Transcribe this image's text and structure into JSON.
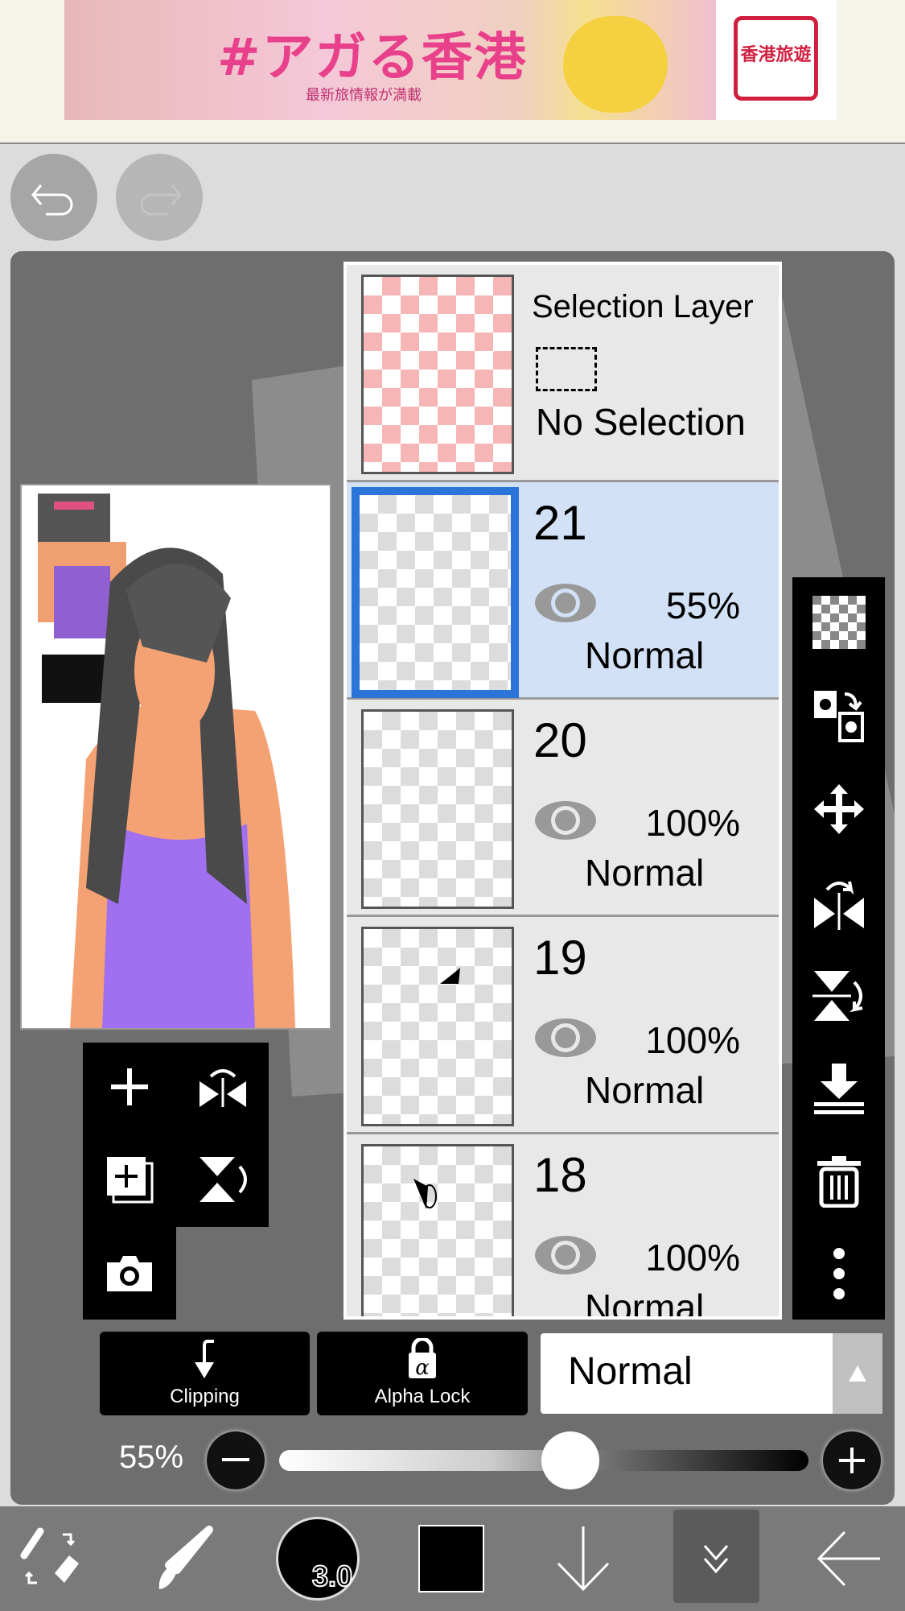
{
  "ad": {
    "title": "#アガる香港",
    "subtitle": "最新旅情報が満載",
    "logo": "香港旅遊"
  },
  "history": {
    "undo_icon": "undo-icon",
    "redo_icon": "redo-icon"
  },
  "layers": [
    {
      "type": "selection",
      "title": "Selection Layer",
      "status": "No Selection"
    },
    {
      "number": "21",
      "opacity": "55%",
      "blend": "Normal",
      "visible": true,
      "selected": true
    },
    {
      "number": "20",
      "opacity": "100%",
      "blend": "Normal",
      "visible": true
    },
    {
      "number": "19",
      "opacity": "100%",
      "blend": "Normal",
      "visible": true
    },
    {
      "number": "18",
      "opacity": "100%",
      "blend": "Normal",
      "visible": true
    }
  ],
  "right_tools": [
    "transparency-icon",
    "transfer-icon",
    "move-icon",
    "flip-horizontal-icon",
    "flip-vertical-icon",
    "merge-down-icon",
    "trash-icon",
    "more-icon"
  ],
  "left_tools": [
    "add-layer-icon",
    "flip-horizontal-icon",
    "duplicate-layer-icon",
    "flip-vertical-icon",
    "camera-icon"
  ],
  "controls": {
    "clipping": "Clipping",
    "alpha_lock": "Alpha Lock",
    "blend_mode": "Normal",
    "opacity_label": "55%",
    "opacity_value": 55
  },
  "bottom": {
    "brush_size": "3.0",
    "color": "#000000",
    "selected_tab": "layers"
  },
  "colors": {
    "selected_layer_bg": "#d2e1f5",
    "selected_border": "#2b74d8",
    "selection_check": "#f7b6b6"
  }
}
